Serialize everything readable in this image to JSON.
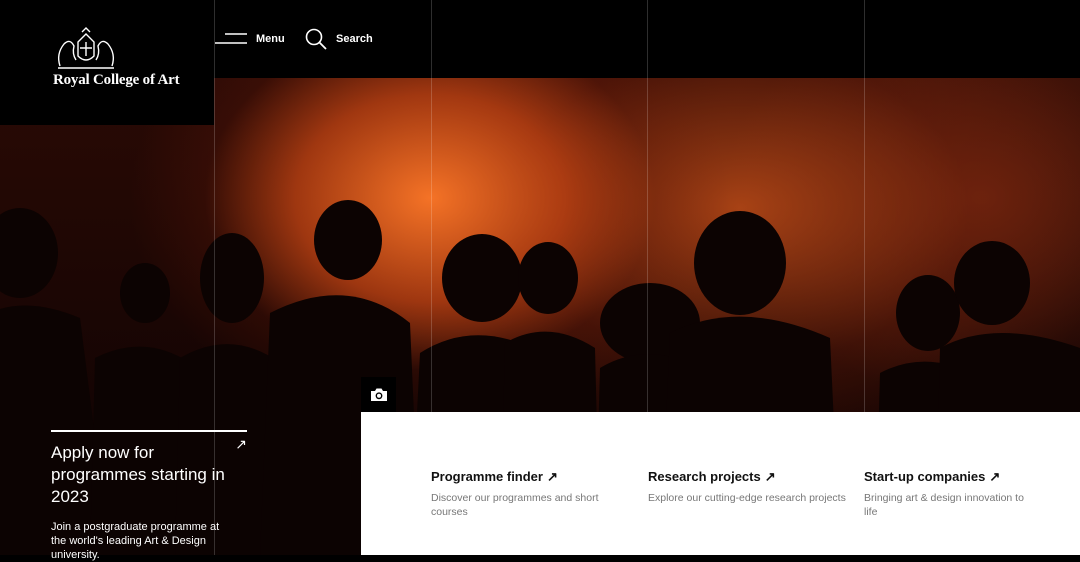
{
  "header": {
    "logo_text": "Royal College of Art",
    "menu_label": "Menu",
    "search_label": "Search"
  },
  "hero": {
    "apply_title": "Apply now for programmes starting in 2023",
    "apply_desc": "Join a postgraduate programme at the world's leading Art & Design university.",
    "apply_arrow": "↗",
    "image_credit_icon": "camera-icon"
  },
  "cards": [
    {
      "title": "Programme finder",
      "arrow": "↗",
      "desc": "Discover our programmes and short courses"
    },
    {
      "title": "Research projects",
      "arrow": "↗",
      "desc": "Explore our cutting-edge research projects"
    },
    {
      "title": "Start-up companies",
      "arrow": "↗",
      "desc": "Bringing art & design innovation to life"
    }
  ],
  "icons": {
    "menu": "hamburger-icon",
    "search": "search-icon",
    "crest": "coat-of-arms-icon",
    "camera": "camera-icon"
  },
  "colors": {
    "accent_orange": "#e8601c",
    "background": "#000000",
    "panel": "#ffffff",
    "muted_text": "#777777"
  }
}
